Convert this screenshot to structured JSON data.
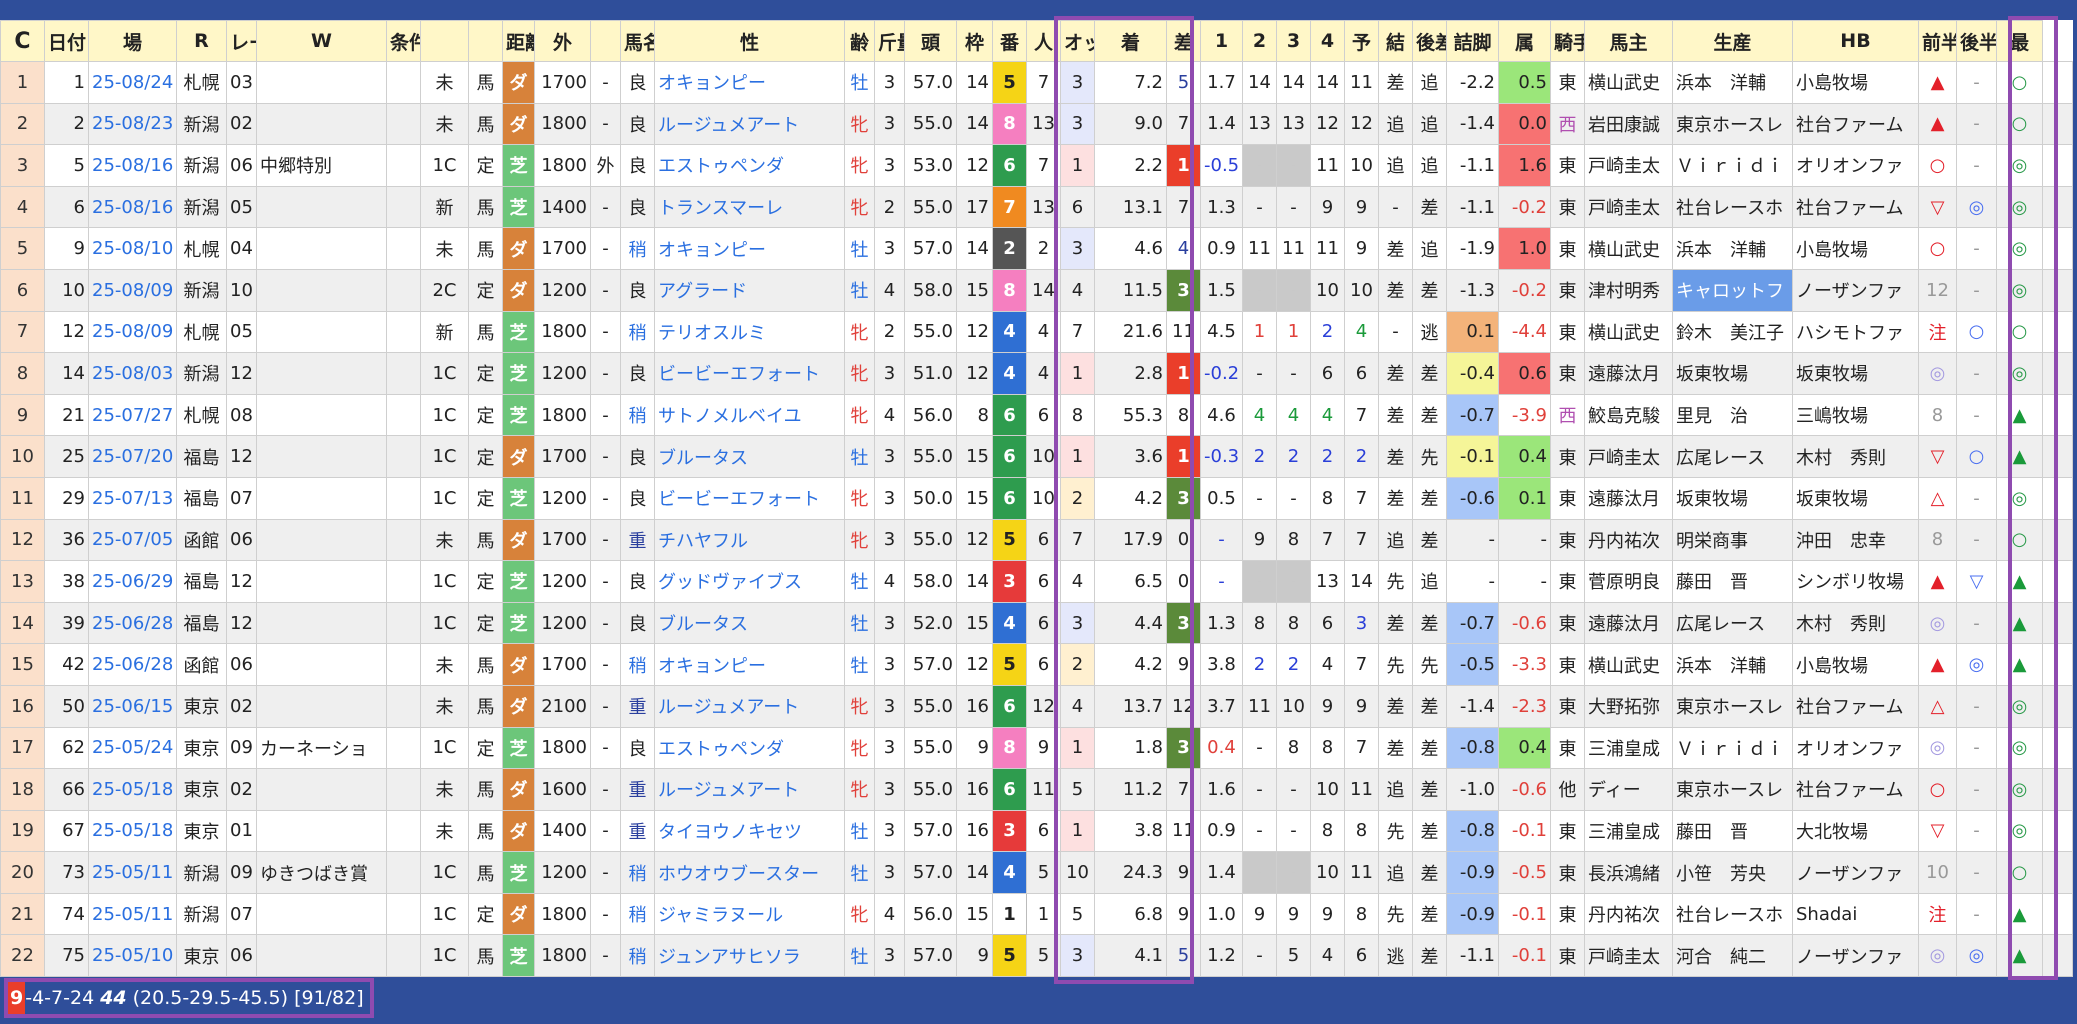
{
  "header": {
    "refresh": "C",
    "cols": [
      "日付",
      "場",
      "R",
      "レース名",
      "W",
      "条件",
      "",
      "",
      "距離",
      "外",
      "",
      "馬名",
      "性",
      "齢",
      "斤量",
      "頭",
      "枠",
      "番",
      "人",
      "オッズ",
      "着",
      "差",
      "1",
      "2",
      "3",
      "4",
      "予",
      "結",
      "後差",
      "詰脚",
      "属",
      "騎手",
      "馬主",
      "生産",
      "HB",
      "前半",
      "後半",
      "最"
    ]
  },
  "rows": [
    [
      "1",
      "1",
      "25-08/24",
      "札幌",
      "03",
      "",
      "",
      "未",
      "馬",
      "ダ",
      "1700",
      "-",
      "良",
      "オキョンピー",
      "牡",
      "3",
      "57.0",
      "14",
      "5",
      "7",
      "3",
      "7.2",
      "5",
      "1.7",
      "14",
      "14",
      "14",
      "11",
      "差",
      "追",
      "-2.2",
      "0.5",
      "東",
      "横山武史",
      "浜本　洋輔",
      "小島牧場",
      "▲",
      "-",
      "○"
    ],
    [
      "2",
      "2",
      "25-08/23",
      "新潟",
      "02",
      "",
      "",
      "未",
      "馬",
      "ダ",
      "1800",
      "-",
      "良",
      "ルージュメアート",
      "牝",
      "3",
      "55.0",
      "14",
      "8",
      "13",
      "3",
      "9.0",
      "7",
      "1.4",
      "13",
      "13",
      "12",
      "12",
      "追",
      "追",
      "-1.4",
      "0.0",
      "西",
      "岩田康誠",
      "東京ホースレ",
      "社台ファーム",
      "▲",
      "-",
      "○"
    ],
    [
      "3",
      "5",
      "25-08/16",
      "新潟",
      "06",
      "中郷特別",
      "",
      "1C",
      "定",
      "芝",
      "1800",
      "外",
      "良",
      "エストゥペンダ",
      "牝",
      "3",
      "53.0",
      "12",
      "6",
      "7",
      "1",
      "2.2",
      "1",
      "-0.5",
      "-",
      "-",
      "11",
      "10",
      "追",
      "追",
      "-1.1",
      "1.6",
      "東",
      "戸崎圭太",
      "Ｖｉｒｉｄｉ",
      "オリオンファ",
      "○",
      "-",
      "◎"
    ],
    [
      "4",
      "6",
      "25-08/16",
      "新潟",
      "05",
      "",
      "",
      "新",
      "馬",
      "芝",
      "1400",
      "-",
      "良",
      "トランスマーレ",
      "牝",
      "2",
      "55.0",
      "17",
      "7",
      "13",
      "6",
      "13.1",
      "7",
      "1.3",
      "-",
      "-",
      "9",
      "9",
      "-",
      "差",
      "-1.1",
      "-0.2",
      "東",
      "戸崎圭太",
      "社台レースホ",
      "社台ファーム",
      "▽",
      "◎",
      "◎"
    ],
    [
      "5",
      "9",
      "25-08/10",
      "札幌",
      "04",
      "",
      "",
      "未",
      "馬",
      "ダ",
      "1700",
      "-",
      "稍",
      "オキョンピー",
      "牡",
      "3",
      "57.0",
      "14",
      "2",
      "2",
      "3",
      "4.6",
      "4",
      "0.9",
      "11",
      "11",
      "11",
      "9",
      "差",
      "追",
      "-1.9",
      "1.0",
      "東",
      "横山武史",
      "浜本　洋輔",
      "小島牧場",
      "○",
      "-",
      "◎"
    ],
    [
      "6",
      "10",
      "25-08/09",
      "新潟",
      "10",
      "",
      "",
      "2C",
      "定",
      "ダ",
      "1200",
      "-",
      "良",
      "アグラード",
      "牡",
      "4",
      "58.0",
      "15",
      "8",
      "14",
      "4",
      "11.5",
      "3",
      "1.5",
      "-",
      "-",
      "10",
      "10",
      "差",
      "差",
      "-1.3",
      "-0.2",
      "東",
      "津村明秀",
      "キャロットフ",
      "ノーザンファ",
      "12",
      "-",
      "◎"
    ],
    [
      "7",
      "12",
      "25-08/09",
      "札幌",
      "05",
      "",
      "",
      "新",
      "馬",
      "芝",
      "1800",
      "-",
      "稍",
      "テリオスルミ",
      "牝",
      "2",
      "55.0",
      "12",
      "4",
      "4",
      "7",
      "21.6",
      "11",
      "4.5",
      "1",
      "1",
      "2",
      "4",
      "-",
      "逃",
      "0.1",
      "-4.4",
      "東",
      "横山武史",
      "鈴木　美江子",
      "ハシモトファ",
      "注",
      "○",
      "○"
    ],
    [
      "8",
      "14",
      "25-08/03",
      "新潟",
      "12",
      "",
      "",
      "1C",
      "定",
      "芝",
      "1200",
      "-",
      "良",
      "ビービーエフォート",
      "牝",
      "3",
      "51.0",
      "12",
      "4",
      "4",
      "1",
      "2.8",
      "1",
      "-0.2",
      "-",
      "-",
      "6",
      "6",
      "差",
      "差",
      "-0.4",
      "0.6",
      "東",
      "遠藤汰月",
      "坂東牧場",
      "坂東牧場",
      "◎",
      "-",
      "◎"
    ],
    [
      "9",
      "21",
      "25-07/27",
      "札幌",
      "08",
      "",
      "",
      "1C",
      "定",
      "芝",
      "1800",
      "-",
      "稍",
      "サトノメルベイユ",
      "牝",
      "4",
      "56.0",
      "8",
      "6",
      "6",
      "8",
      "55.3",
      "8",
      "4.6",
      "4",
      "4",
      "4",
      "7",
      "差",
      "差",
      "-0.7",
      "-3.9",
      "西",
      "鮫島克駿",
      "里見　治",
      "三嶋牧場",
      "8",
      "-",
      "▲"
    ],
    [
      "10",
      "25",
      "25-07/20",
      "福島",
      "12",
      "",
      "",
      "1C",
      "定",
      "ダ",
      "1700",
      "-",
      "良",
      "ブルータス",
      "牡",
      "3",
      "55.0",
      "15",
      "6",
      "10",
      "1",
      "3.6",
      "1",
      "-0.3",
      "2",
      "2",
      "2",
      "2",
      "差",
      "先",
      "-0.1",
      "0.4",
      "東",
      "戸崎圭太",
      "広尾レース",
      "木村　秀則",
      "▽",
      "○",
      "▲"
    ],
    [
      "11",
      "29",
      "25-07/13",
      "福島",
      "07",
      "",
      "",
      "1C",
      "定",
      "芝",
      "1200",
      "-",
      "良",
      "ビービーエフォート",
      "牝",
      "3",
      "50.0",
      "15",
      "6",
      "10",
      "2",
      "4.2",
      "3",
      "0.5",
      "-",
      "-",
      "8",
      "7",
      "差",
      "差",
      "-0.6",
      "0.1",
      "東",
      "遠藤汰月",
      "坂東牧場",
      "坂東牧場",
      "△",
      "-",
      "◎"
    ],
    [
      "12",
      "36",
      "25-07/05",
      "函館",
      "06",
      "",
      "",
      "未",
      "馬",
      "ダ",
      "1700",
      "-",
      "重",
      "チハヤフル",
      "牝",
      "3",
      "55.0",
      "12",
      "5",
      "6",
      "7",
      "17.9",
      "0",
      "-",
      "9",
      "8",
      "7",
      "7",
      "追",
      "差",
      "-",
      "-",
      "東",
      "丹内祐次",
      "明栄商事",
      "沖田　忠幸",
      "8",
      "-",
      "○"
    ],
    [
      "13",
      "38",
      "25-06/29",
      "福島",
      "12",
      "",
      "",
      "1C",
      "定",
      "芝",
      "1200",
      "-",
      "良",
      "グッドヴァイブス",
      "牡",
      "4",
      "58.0",
      "14",
      "3",
      "6",
      "4",
      "6.5",
      "0",
      "-",
      "-",
      "-",
      "13",
      "14",
      "先",
      "追",
      "-",
      "-",
      "東",
      "菅原明良",
      "藤田　晋",
      "シンボリ牧場",
      "▲",
      "▽",
      "▲"
    ],
    [
      "14",
      "39",
      "25-06/28",
      "福島",
      "12",
      "",
      "",
      "1C",
      "定",
      "芝",
      "1200",
      "-",
      "良",
      "ブルータス",
      "牡",
      "3",
      "52.0",
      "15",
      "4",
      "6",
      "3",
      "4.4",
      "3",
      "1.3",
      "8",
      "8",
      "6",
      "3",
      "差",
      "差",
      "-0.7",
      "-0.6",
      "東",
      "遠藤汰月",
      "広尾レース",
      "木村　秀則",
      "◎",
      "-",
      "▲"
    ],
    [
      "15",
      "42",
      "25-06/28",
      "函館",
      "06",
      "",
      "",
      "未",
      "馬",
      "ダ",
      "1700",
      "-",
      "稍",
      "オキョンピー",
      "牡",
      "3",
      "57.0",
      "12",
      "5",
      "6",
      "2",
      "4.2",
      "9",
      "3.8",
      "2",
      "2",
      "4",
      "7",
      "先",
      "先",
      "-0.5",
      "-3.3",
      "東",
      "横山武史",
      "浜本　洋輔",
      "小島牧場",
      "▲",
      "◎",
      "▲"
    ],
    [
      "16",
      "50",
      "25-06/15",
      "東京",
      "02",
      "",
      "",
      "未",
      "馬",
      "ダ",
      "2100",
      "-",
      "重",
      "ルージュメアート",
      "牝",
      "3",
      "55.0",
      "16",
      "6",
      "12",
      "4",
      "13.7",
      "12",
      "3.7",
      "11",
      "10",
      "9",
      "9",
      "差",
      "差",
      "-1.4",
      "-2.3",
      "東",
      "大野拓弥",
      "東京ホースレ",
      "社台ファーム",
      "△",
      "-",
      "◎"
    ],
    [
      "17",
      "62",
      "25-05/24",
      "東京",
      "09",
      "カーネーショ",
      "",
      "1C",
      "定",
      "芝",
      "1800",
      "-",
      "良",
      "エストゥペンダ",
      "牝",
      "3",
      "55.0",
      "9",
      "8",
      "9",
      "1",
      "1.8",
      "3",
      "0.4",
      "-",
      "8",
      "8",
      "7",
      "差",
      "差",
      "-0.8",
      "0.4",
      "東",
      "三浦皇成",
      "Ｖｉｒｉｄｉ",
      "オリオンファ",
      "◎",
      "-",
      "◎"
    ],
    [
      "18",
      "66",
      "25-05/18",
      "東京",
      "02",
      "",
      "",
      "未",
      "馬",
      "ダ",
      "1600",
      "-",
      "重",
      "ルージュメアート",
      "牝",
      "3",
      "55.0",
      "16",
      "6",
      "11",
      "5",
      "11.2",
      "7",
      "1.6",
      "-",
      "-",
      "10",
      "11",
      "追",
      "差",
      "-1.0",
      "-0.6",
      "他",
      "ディー",
      "東京ホースレ",
      "社台ファーム",
      "○",
      "-",
      "◎"
    ],
    [
      "19",
      "67",
      "25-05/18",
      "東京",
      "01",
      "",
      "",
      "未",
      "馬",
      "ダ",
      "1400",
      "-",
      "重",
      "タイヨウノキセツ",
      "牡",
      "3",
      "57.0",
      "16",
      "3",
      "6",
      "1",
      "3.8",
      "11",
      "0.9",
      "-",
      "-",
      "8",
      "8",
      "先",
      "差",
      "-0.8",
      "-0.1",
      "東",
      "三浦皇成",
      "藤田　晋",
      "大北牧場",
      "▽",
      "-",
      "◎"
    ],
    [
      "20",
      "73",
      "25-05/11",
      "新潟",
      "09",
      "ゆきつばき賞",
      "",
      "1C",
      "馬",
      "芝",
      "1200",
      "-",
      "稍",
      "ホウオウブースター",
      "牡",
      "3",
      "57.0",
      "14",
      "4",
      "5",
      "10",
      "24.3",
      "9",
      "1.4",
      "-",
      "-",
      "10",
      "11",
      "追",
      "差",
      "-0.9",
      "-0.5",
      "東",
      "長浜鴻緒",
      "小笹　芳央",
      "ノーザンファ",
      "10",
      "-",
      "○"
    ],
    [
      "21",
      "74",
      "25-05/11",
      "新潟",
      "07",
      "",
      "",
      "1C",
      "定",
      "ダ",
      "1800",
      "-",
      "稍",
      "ジャミラヌール",
      "牝",
      "4",
      "56.0",
      "15",
      "1",
      "1",
      "5",
      "6.8",
      "9",
      "1.0",
      "9",
      "9",
      "9",
      "8",
      "先",
      "差",
      "-0.9",
      "-0.1",
      "東",
      "丹内祐次",
      "社台レースホ",
      "Shadai",
      "注",
      "-",
      "▲"
    ],
    [
      "22",
      "75",
      "25-05/10",
      "東京",
      "06",
      "",
      "",
      "1C",
      "馬",
      "芝",
      "1800",
      "-",
      "稍",
      "ジュンアサヒソラ",
      "牡",
      "3",
      "57.0",
      "9",
      "5",
      "5",
      "3",
      "4.1",
      "5",
      "1.2",
      "-",
      "5",
      "4",
      "6",
      "逃",
      "差",
      "-1.1",
      "-0.1",
      "東",
      "戸崎圭太",
      "河合　純二",
      "ノーザンファ",
      "◎",
      "◎",
      "▲"
    ]
  ],
  "footer": {
    "hit": "9",
    "record": "-4-7-24",
    "total": "44",
    "rates": "(20.5-29.5-45.5)",
    "count": "[91/82]"
  }
}
